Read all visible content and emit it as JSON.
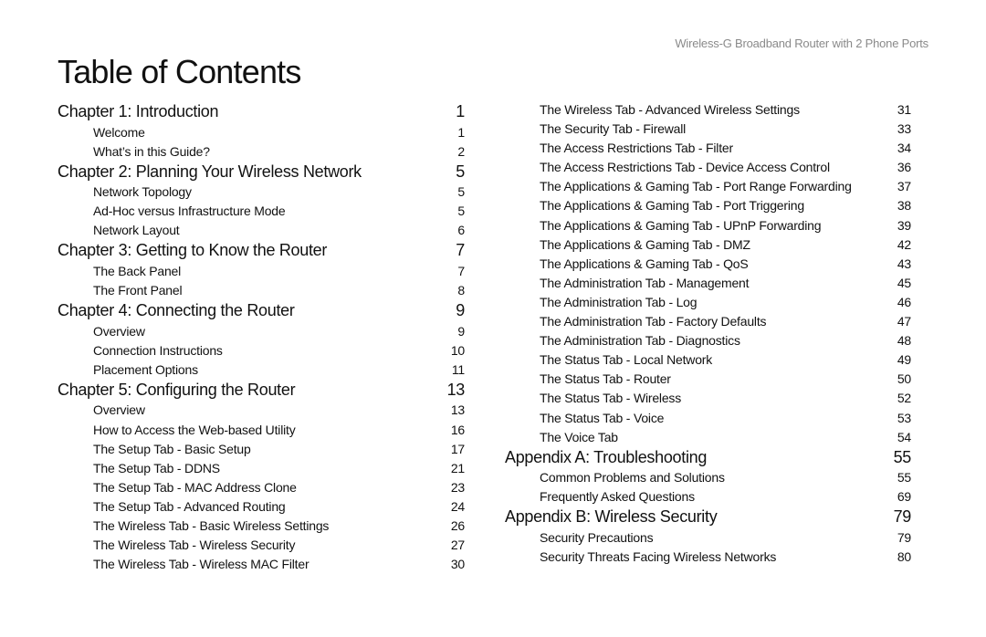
{
  "header": {
    "running_title": "Wireless-G Broadband Router with 2 Phone Ports"
  },
  "page_title": "Table of Contents",
  "left_column": [
    {
      "type": "chapter",
      "title": "Chapter 1: Introduction",
      "page": "1"
    },
    {
      "type": "section",
      "title": "Welcome",
      "page": "1"
    },
    {
      "type": "section",
      "title": "What’s in this Guide?",
      "page": "2"
    },
    {
      "type": "chapter",
      "title": "Chapter 2: Planning Your Wireless Network",
      "page": "5"
    },
    {
      "type": "section",
      "title": "Network Topology",
      "page": "5"
    },
    {
      "type": "section",
      "title": "Ad-Hoc versus Infrastructure Mode",
      "page": "5"
    },
    {
      "type": "section",
      "title": "Network Layout",
      "page": "6"
    },
    {
      "type": "chapter",
      "title": "Chapter 3: Getting to Know the Router",
      "page": "7"
    },
    {
      "type": "section",
      "title": "The Back Panel",
      "page": "7"
    },
    {
      "type": "section",
      "title": "The Front Panel",
      "page": "8"
    },
    {
      "type": "chapter",
      "title": "Chapter 4: Connecting the Router",
      "page": "9"
    },
    {
      "type": "section",
      "title": "Overview",
      "page": "9"
    },
    {
      "type": "section",
      "title": "Connection Instructions",
      "page": "10"
    },
    {
      "type": "section",
      "title": "Placement Options",
      "page": "11"
    },
    {
      "type": "chapter",
      "title": "Chapter 5: Configuring the Router",
      "page": "13"
    },
    {
      "type": "section",
      "title": "Overview",
      "page": "13"
    },
    {
      "type": "section",
      "title": "How to Access the Web-based Utility",
      "page": "16"
    },
    {
      "type": "section",
      "title": "The Setup Tab - Basic Setup",
      "page": "17"
    },
    {
      "type": "section",
      "title": "The Setup Tab - DDNS",
      "page": "21"
    },
    {
      "type": "section",
      "title": "The Setup Tab - MAC Address Clone",
      "page": "23"
    },
    {
      "type": "section",
      "title": "The Setup Tab - Advanced Routing",
      "page": "24"
    },
    {
      "type": "section",
      "title": "The Wireless Tab - Basic Wireless Settings",
      "page": "26"
    },
    {
      "type": "section",
      "title": "The Wireless Tab - Wireless Security",
      "page": "27"
    },
    {
      "type": "section",
      "title": "The Wireless Tab - Wireless MAC Filter",
      "page": "30"
    }
  ],
  "right_column": [
    {
      "type": "section",
      "title": "The Wireless Tab - Advanced Wireless Settings",
      "page": "31"
    },
    {
      "type": "section",
      "title": "The Security Tab - Firewall",
      "page": "33"
    },
    {
      "type": "section",
      "title": "The Access Restrictions Tab - Filter",
      "page": "34"
    },
    {
      "type": "section",
      "title": "The Access Restrictions Tab - Device Access Control",
      "page": "36"
    },
    {
      "type": "section",
      "title": "The Applications & Gaming Tab - Port Range Forwarding",
      "page": "37"
    },
    {
      "type": "section",
      "title": "The Applications & Gaming Tab - Port Triggering",
      "page": "38"
    },
    {
      "type": "section",
      "title": "The Applications & Gaming Tab - UPnP Forwarding",
      "page": "39"
    },
    {
      "type": "section",
      "title": "The Applications & Gaming Tab - DMZ",
      "page": "42"
    },
    {
      "type": "section",
      "title": "The Applications & Gaming Tab - QoS",
      "page": "43"
    },
    {
      "type": "section",
      "title": "The Administration Tab - Management",
      "page": "45"
    },
    {
      "type": "section",
      "title": "The Administration Tab - Log",
      "page": "46"
    },
    {
      "type": "section",
      "title": "The Administration Tab - Factory Defaults",
      "page": "47"
    },
    {
      "type": "section",
      "title": "The Administration Tab - Diagnostics",
      "page": "48"
    },
    {
      "type": "section",
      "title": "The Status Tab - Local Network",
      "page": "49"
    },
    {
      "type": "section",
      "title": "The Status Tab - Router",
      "page": "50"
    },
    {
      "type": "section",
      "title": "The Status Tab - Wireless",
      "page": "52"
    },
    {
      "type": "section",
      "title": "The Status Tab - Voice",
      "page": "53"
    },
    {
      "type": "section",
      "title": "The Voice Tab",
      "page": "54"
    },
    {
      "type": "chapter",
      "title": "Appendix A: Troubleshooting",
      "page": "55"
    },
    {
      "type": "section",
      "title": "Common Problems and Solutions",
      "page": "55"
    },
    {
      "type": "section",
      "title": "Frequently Asked Questions",
      "page": "69"
    },
    {
      "type": "chapter",
      "title": "Appendix B: Wireless Security",
      "page": "79"
    },
    {
      "type": "section",
      "title": "Security Precautions",
      "page": "79"
    },
    {
      "type": "section",
      "title": "Security Threats Facing Wireless Networks",
      "page": "80"
    }
  ]
}
